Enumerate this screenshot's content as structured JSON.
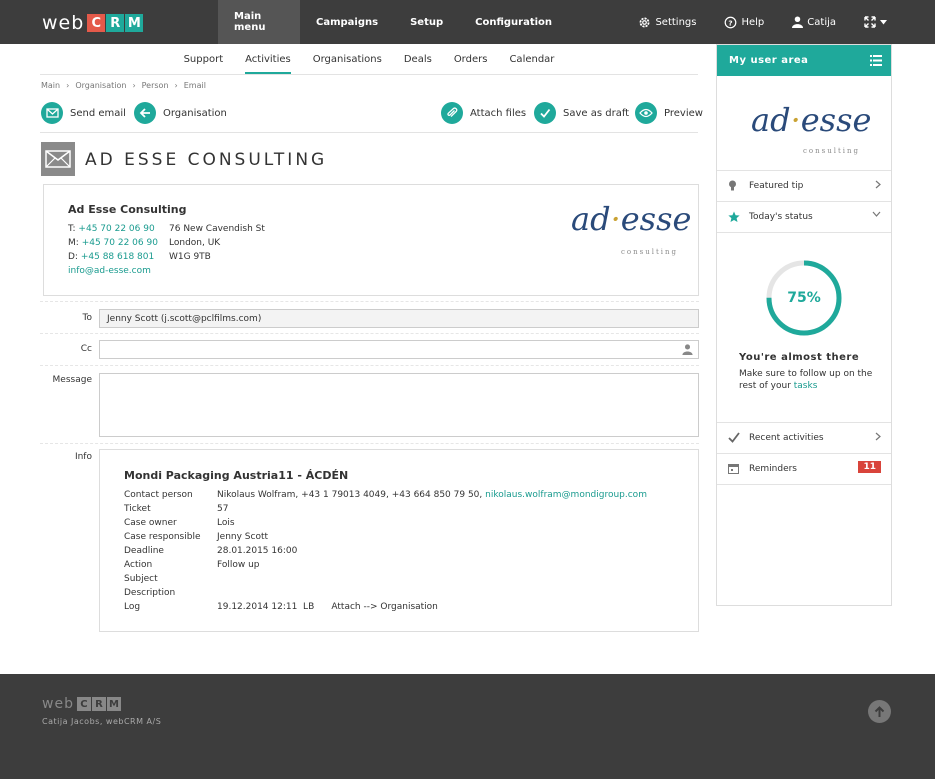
{
  "app": {
    "logo_web": "web",
    "logo_letters": [
      "C",
      "R",
      "M"
    ]
  },
  "mainnav": [
    {
      "label": "Main menu",
      "active": true
    },
    {
      "label": "Campaigns",
      "active": false
    },
    {
      "label": "Setup",
      "active": false
    },
    {
      "label": "Configuration",
      "active": false
    }
  ],
  "rightnav": {
    "settings": "Settings",
    "help": "Help",
    "user": "Catija"
  },
  "subnav": [
    {
      "label": "Support",
      "active": false
    },
    {
      "label": "Activities",
      "active": true
    },
    {
      "label": "Organisations",
      "active": false
    },
    {
      "label": "Deals",
      "active": false
    },
    {
      "label": "Orders",
      "active": false
    },
    {
      "label": "Calendar",
      "active": false
    }
  ],
  "breadcrumb": [
    "Main",
    "›",
    "Organisation",
    "›",
    "Person",
    "›",
    "Email"
  ],
  "toolbar": {
    "send_email": "Send email",
    "organisation": "Organisation",
    "attach_files": "Attach files",
    "save_draft": "Save as draft",
    "preview": "Preview"
  },
  "page_title": "AD ESSE CONSULTING",
  "company": {
    "name": "Ad Esse Consulting",
    "t_label": "T:",
    "t_value": "+45 70 22 06 90",
    "m_label": "M:",
    "m_value": "+45 70 22 06 90",
    "d_label": "D:",
    "d_value": "+45 88 618 801",
    "email": "info@ad-esse.com",
    "address_1": "76 New Cavendish St",
    "address_2": "London, UK",
    "address_3": "W1G 9TB",
    "logo_text_a": "ad",
    "logo_text_b": "esse",
    "logo_sub": "consulting"
  },
  "form": {
    "to_label": "To",
    "to_value": "Jenny Scott (j.scott@pclfilms.com)",
    "cc_label": "Cc",
    "cc_value": "",
    "message_label": "Message",
    "message_value": "",
    "info_label": "Info"
  },
  "info": {
    "title": "Mondi Packaging Austria11 - ÁCDÉN",
    "rows": [
      {
        "k": "Contact person",
        "v": "Nikolaus Wolfram, +43 1 79013 4049, +43 664 850 79 50,",
        "link": "nikolaus.wolfram@mondigroup.com"
      },
      {
        "k": "Ticket",
        "v": "57"
      },
      {
        "k": "Case owner",
        "v": "Lois"
      },
      {
        "k": "Case responsible",
        "v": "Jenny Scott"
      },
      {
        "k": "Deadline",
        "v": "28.01.2015 16:00"
      },
      {
        "k": "Action",
        "v": "Follow up"
      },
      {
        "k": "Subject",
        "v": ""
      },
      {
        "k": "Description",
        "v": ""
      },
      {
        "k": "Log",
        "v": "19.12.2014 12:11  LB      Attach --> Organisation"
      }
    ]
  },
  "user_area": {
    "title": "My user area",
    "featured_tip": "Featured tip",
    "todays_status": "Today's status",
    "progress_label": "75%",
    "progress_fraction": 0.75,
    "almost_title": "You're almost there",
    "almost_desc": "Make sure to follow up on the rest of your",
    "almost_link": "tasks",
    "recent": "Recent activities",
    "reminders": "Reminders",
    "reminders_count": "11"
  },
  "footer": {
    "copyright": "Catija Jacobs,  webCRM A/S"
  },
  "colors": {
    "accent": "#1fa99b",
    "topbar": "#3d3d3d",
    "badge": "#d9443b",
    "logo_c": "#e45a4a"
  }
}
